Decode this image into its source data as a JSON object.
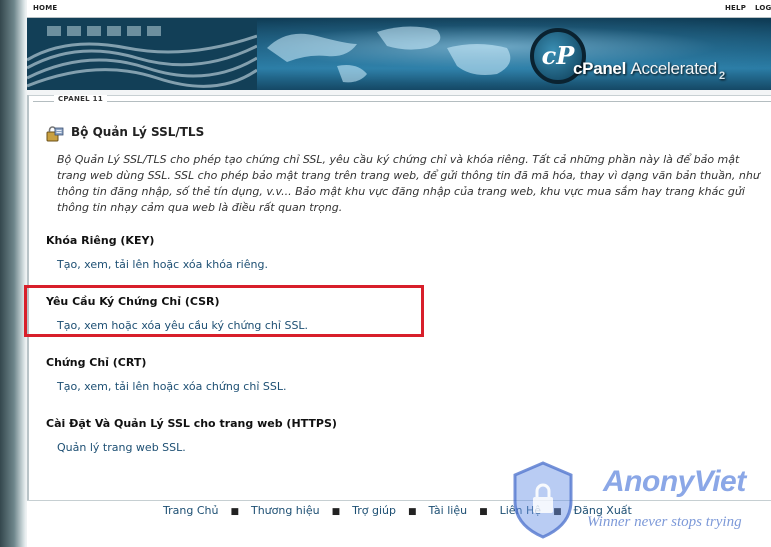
{
  "topbar": {
    "home": "HOME",
    "help": "HELP",
    "logout": "LOG"
  },
  "logo": {
    "letters": "cP",
    "brand": "cPanel",
    "accelerated": "Accelerated",
    "version": "2"
  },
  "breadcrumb": "CPANEL 11",
  "page": {
    "title": "Bộ Quản Lý SSL/TLS",
    "intro": "Bộ Quản Lý SSL/TLS cho phép tạo chứng chỉ SSL, yêu cầu ký chứng chỉ và khóa riêng. Tất cả những phần này là để bảo mật trang web dùng SSL. SSL cho phép bảo mật trang trên trang web, để gửi thông tin đã mã hóa, thay vì dạng văn bản thuần, như thông tin đăng nhập, số thẻ tín dụng, v.v... Bảo mật khu vực đăng nhập của trang web, khu vực mua sắm hay trang khác gửi thông tin nhạy cảm qua web là điều rất quan trọng."
  },
  "sections": [
    {
      "title": "Khóa Riêng (KEY)",
      "link": "Tạo, xem, tải lên hoặc xóa khóa riêng."
    },
    {
      "title": "Yêu Cầu Ký Chứng Chỉ (CSR)",
      "link": "Tạo, xem hoặc xóa yêu cầu ký chứng chỉ SSL."
    },
    {
      "title": "Chứng Chỉ (CRT)",
      "link": "Tạo, xem, tải lên hoặc xóa chứng chỉ SSL."
    },
    {
      "title": "Cài Đặt Và Quản Lý SSL cho trang web (HTTPS)",
      "link": "Quản lý trang web SSL."
    }
  ],
  "footer": {
    "links": [
      "Trang Chủ",
      "Thương hiệu",
      "Trợ giúp",
      "Tài liệu",
      "Liên Hệ",
      "Đăng Xuất"
    ],
    "separator": "■"
  },
  "watermark": {
    "name": "AnonyViet",
    "tagline": "Winner never stops trying"
  },
  "colors": {
    "highlight": "#d81f2a",
    "link": "#1d4f73",
    "banner": "#1c6185"
  }
}
